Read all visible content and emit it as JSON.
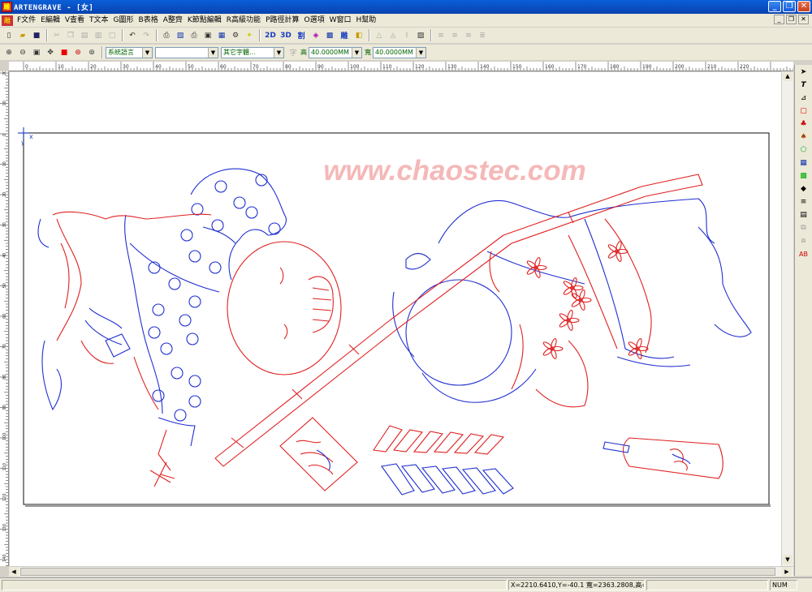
{
  "window": {
    "title": "ARTENGRAVE - [女]",
    "app_icon": "雕"
  },
  "menu": [
    "F文件",
    "E編輯",
    "V查看",
    "T文本",
    "G圖形",
    "B表格",
    "A整齊",
    "K節點編輯",
    "R高級功能",
    "P路徑計算",
    "O選項",
    "W窗口",
    "H幫助"
  ],
  "toolbar2": {
    "language": "系統語言",
    "font_name": "",
    "font_style": "其它字體...",
    "height_label": "高",
    "height_value": "40.0000MM",
    "width_label": "寬",
    "width_value": "40.0000MM"
  },
  "toolbar1": {
    "btn_2d": "2D",
    "btn_3d": "3D",
    "btn_cut": "割",
    "btn_carve": "雕"
  },
  "ruler": {
    "h_ticks": [
      "0",
      "10",
      "20",
      "30",
      "40",
      "50",
      "60",
      "70",
      "80",
      "90",
      "100",
      "110",
      "120",
      "130",
      "140",
      "150",
      "160",
      "170",
      "180",
      "190",
      "200",
      "210",
      "220"
    ],
    "v_ticks": [
      "20",
      "10",
      "0",
      "10",
      "20",
      "30",
      "40",
      "50",
      "60",
      "70",
      "80",
      "90",
      "100",
      "110",
      "120",
      "130",
      "140"
    ]
  },
  "canvas": {
    "watermark": "www.chaostec.com",
    "origin_x": "x",
    "origin_y": "y"
  },
  "status": {
    "coords": "X=2210.6410,Y=-40.1 寬=2363.2808,高=1090.2",
    "num": "NUM"
  },
  "colors": {
    "red": "#e02020",
    "blue": "#2030d0",
    "watermark": "#f5b8b8",
    "titlebar": "#0a5fd8"
  },
  "icons": [
    "new-icon",
    "open-icon",
    "save-icon",
    "cut-icon",
    "copy-icon",
    "paste-icon",
    "undo-icon",
    "redo-icon",
    "print-icon",
    "zoom-in-icon",
    "zoom-out-icon",
    "pointer-icon",
    "text-tool-icon"
  ]
}
